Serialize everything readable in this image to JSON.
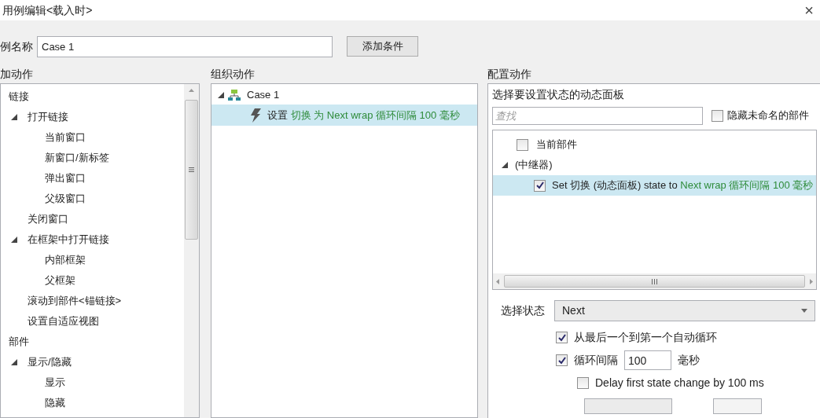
{
  "window": {
    "title": "用例编辑<载入时>",
    "close": "×"
  },
  "case_name": {
    "label": "例名称",
    "value": "Case 1"
  },
  "add_condition_button": "添加条件",
  "add_action": {
    "header": "加动作",
    "tree": [
      {
        "label": "链接",
        "children": [
          {
            "label": "打开链接",
            "expanded": true,
            "children": [
              {
                "label": "当前窗口"
              },
              {
                "label": "新窗口/新标签"
              },
              {
                "label": "弹出窗口"
              },
              {
                "label": "父级窗口"
              }
            ]
          },
          {
            "label": "关闭窗口"
          },
          {
            "label": "在框架中打开链接",
            "expanded": true,
            "children": [
              {
                "label": "内部框架"
              },
              {
                "label": "父框架"
              }
            ]
          },
          {
            "label": "滚动到部件<锚链接>"
          },
          {
            "label": "设置自适应视图"
          }
        ]
      },
      {
        "label": "部件",
        "children": [
          {
            "label": "显示/隐藏",
            "expanded": true,
            "children": [
              {
                "label": "显示"
              },
              {
                "label": "隐藏"
              }
            ]
          }
        ]
      }
    ]
  },
  "organize_actions": {
    "header": "组织动作",
    "cases": [
      {
        "label": "Case 1",
        "expanded": true,
        "actions": [
          {
            "verb": "设置",
            "detail": "切换 为 Next wrap 循环间隔 100 毫秒",
            "selected": true
          }
        ]
      }
    ]
  },
  "configure_action": {
    "header": "配置动作",
    "title": "选择要设置状态的动态面板",
    "search": {
      "placeholder": "查找"
    },
    "hide_unnamed": {
      "label": "隐藏未命名的部件",
      "checked": false
    },
    "widgets": [
      {
        "label": "当前部件",
        "checked": false
      },
      {
        "label": "(中继器)",
        "expanded": true,
        "children": [
          {
            "label": "Set 切换 (动态面板) state to ",
            "detail": "Next wrap 循环间隔 100 毫秒",
            "checked": true,
            "selected": true
          }
        ]
      }
    ],
    "select_state": {
      "label": "选择状态",
      "value": "Next"
    },
    "options": [
      {
        "kind": "check",
        "label": "从最后一个到第一个自动循环",
        "checked": true
      },
      {
        "kind": "interval",
        "label": "循环间隔",
        "value": "100",
        "unit": "毫秒",
        "checked": true
      },
      {
        "label": "Delay first state change by 100 ms",
        "checked": false,
        "kind": "sub_check"
      }
    ]
  }
}
